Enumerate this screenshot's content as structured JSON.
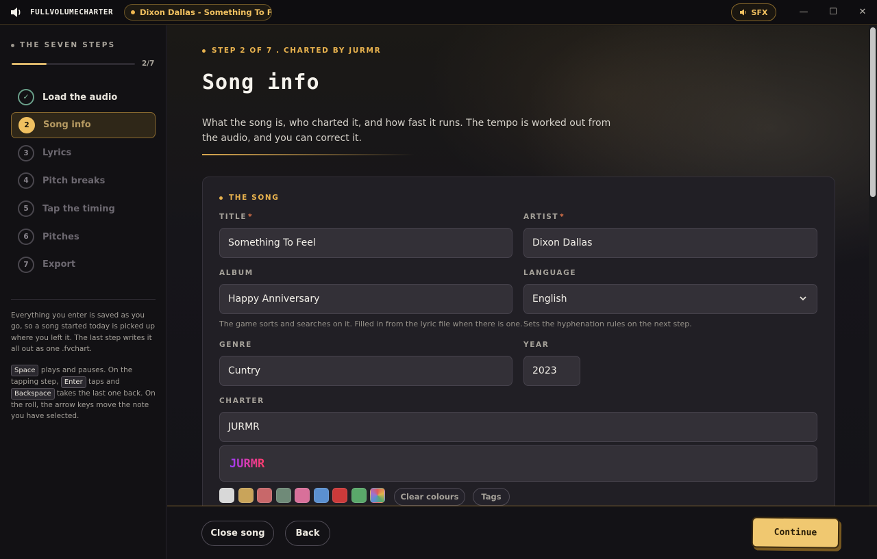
{
  "titlebar": {
    "app_name": "FULLVOLUMECHARTER",
    "song_pill": "Dixon Dallas - Something To Feel",
    "sfx_label": "SFX",
    "minimize": "—",
    "maximize": "☐",
    "close": "✕"
  },
  "sidebar": {
    "header": "THE SEVEN STEPS",
    "progress_count": "2/7",
    "progress_fraction": 0.2857,
    "steps": [
      {
        "num": "✓",
        "label": "Load the audio",
        "state": "done"
      },
      {
        "num": "2",
        "label": "Song info",
        "state": "active"
      },
      {
        "num": "3",
        "label": "Lyrics",
        "state": "pending"
      },
      {
        "num": "4",
        "label": "Pitch breaks",
        "state": "pending"
      },
      {
        "num": "5",
        "label": "Tap the timing",
        "state": "pending"
      },
      {
        "num": "6",
        "label": "Pitches",
        "state": "pending"
      },
      {
        "num": "7",
        "label": "Export",
        "state": "pending"
      }
    ],
    "note_saved": "Everything you enter is saved as you go, so a song started today is picked up where you left it. The last step writes it all out as one .fvchart.",
    "keys": {
      "space": "Space",
      "enter": "Enter",
      "backspace": "Backspace",
      "t1": " plays and pauses. On the tapping step, ",
      "t2": " taps and ",
      "t3": " takes the last one back. On the roll, the arrow keys move the note you have selected."
    }
  },
  "main": {
    "eyebrow": "STEP 2 OF 7 . CHARTED BY JURMR",
    "title": "Song info",
    "description": "What the song is, who charted it, and how fast it runs. The tempo is worked out from the audio, and you can correct it.",
    "card": {
      "heading": "THE SONG",
      "title_label": "TITLE",
      "title_value": "Something To Feel",
      "artist_label": "ARTIST",
      "artist_value": "Dixon Dallas",
      "required_mark": "*",
      "album_label": "ALBUM",
      "album_value": "Happy Anniversary",
      "album_hint": "The game sorts and searches on it. Filled in from the lyric file when there is one.",
      "language_label": "LANGUAGE",
      "language_value": "English",
      "language_hint": "Sets the hyphenation rules on the next step.",
      "genre_label": "GENRE",
      "genre_value": "Cuntry",
      "year_label": "YEAR",
      "year_value": "2023",
      "charter_label": "CHARTER",
      "charter_value": "JURMR",
      "charter_preview": "JURMR",
      "swatches": [
        "#d8d8d8",
        "#c9a45a",
        "#c8686a",
        "#6f8a78",
        "#d8709a",
        "#5b90d0",
        "#cc3a3a",
        "#5aa86a",
        "multi"
      ],
      "clear_colours": "Clear colours",
      "tags": "Tags"
    }
  },
  "footer": {
    "close_song": "Close song",
    "back": "Back",
    "continue": "Continue"
  },
  "colors": {
    "accent": "#f0c060",
    "continue_bg": "#f0c870",
    "required": "#e0754a"
  }
}
